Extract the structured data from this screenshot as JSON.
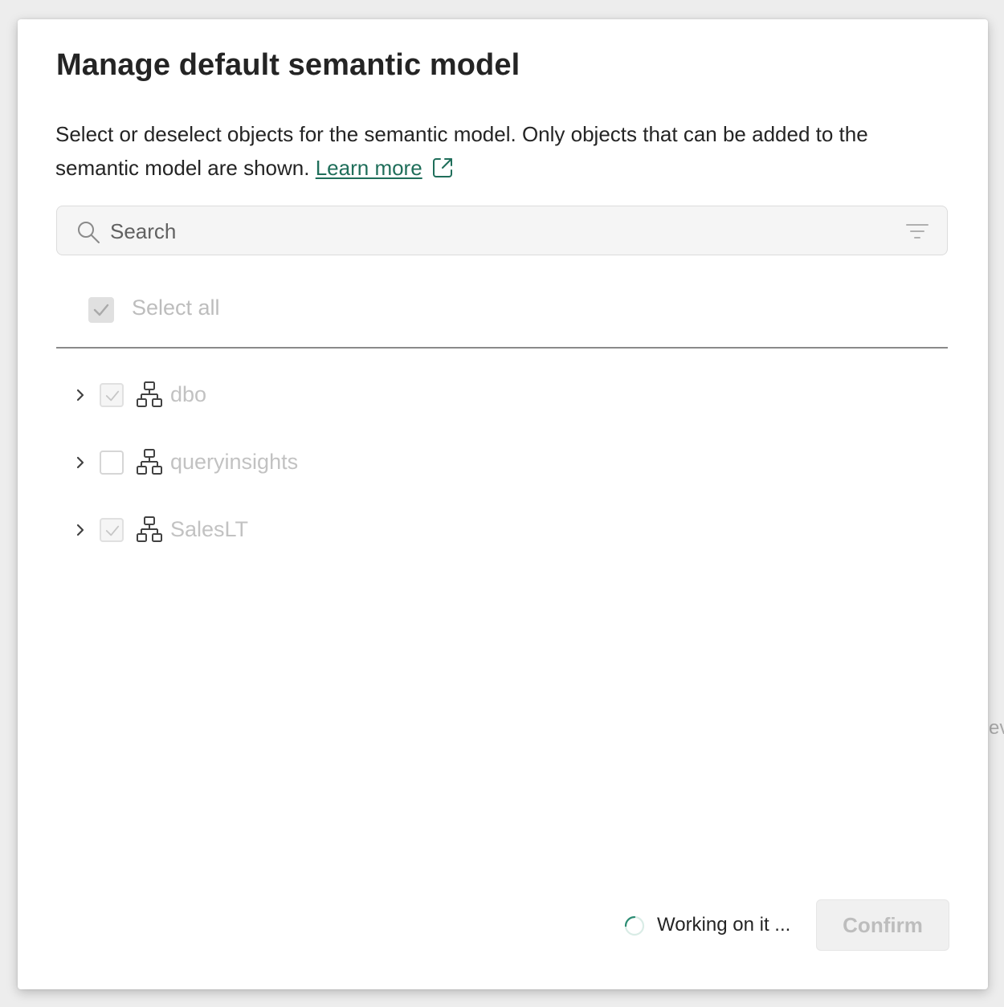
{
  "background": {
    "peek_text": "evi"
  },
  "dialog": {
    "title": "Manage default semantic model",
    "description": "Select or deselect objects for the semantic model. Only objects that can be added to the semantic model are shown.",
    "learn_more_label": "Learn more",
    "search": {
      "placeholder": "Search",
      "value": ""
    },
    "select_all": {
      "label": "Select all",
      "checked": true,
      "disabled": true
    },
    "schemas": [
      {
        "label": "dbo",
        "checked": true,
        "expanded": false,
        "icon": "schema-icon"
      },
      {
        "label": "queryinsights",
        "checked": false,
        "expanded": false,
        "icon": "schema-icon"
      },
      {
        "label": "SalesLT",
        "checked": true,
        "expanded": false,
        "icon": "schema-icon"
      }
    ],
    "footer": {
      "status_text": "Working on it ...",
      "confirm_label": "Confirm",
      "confirm_enabled": false
    }
  },
  "colors": {
    "link": "#1f6e5a",
    "text": "#242424",
    "disabled_text": "#bdbdbd",
    "spinner_accent": "#2c8c73"
  }
}
